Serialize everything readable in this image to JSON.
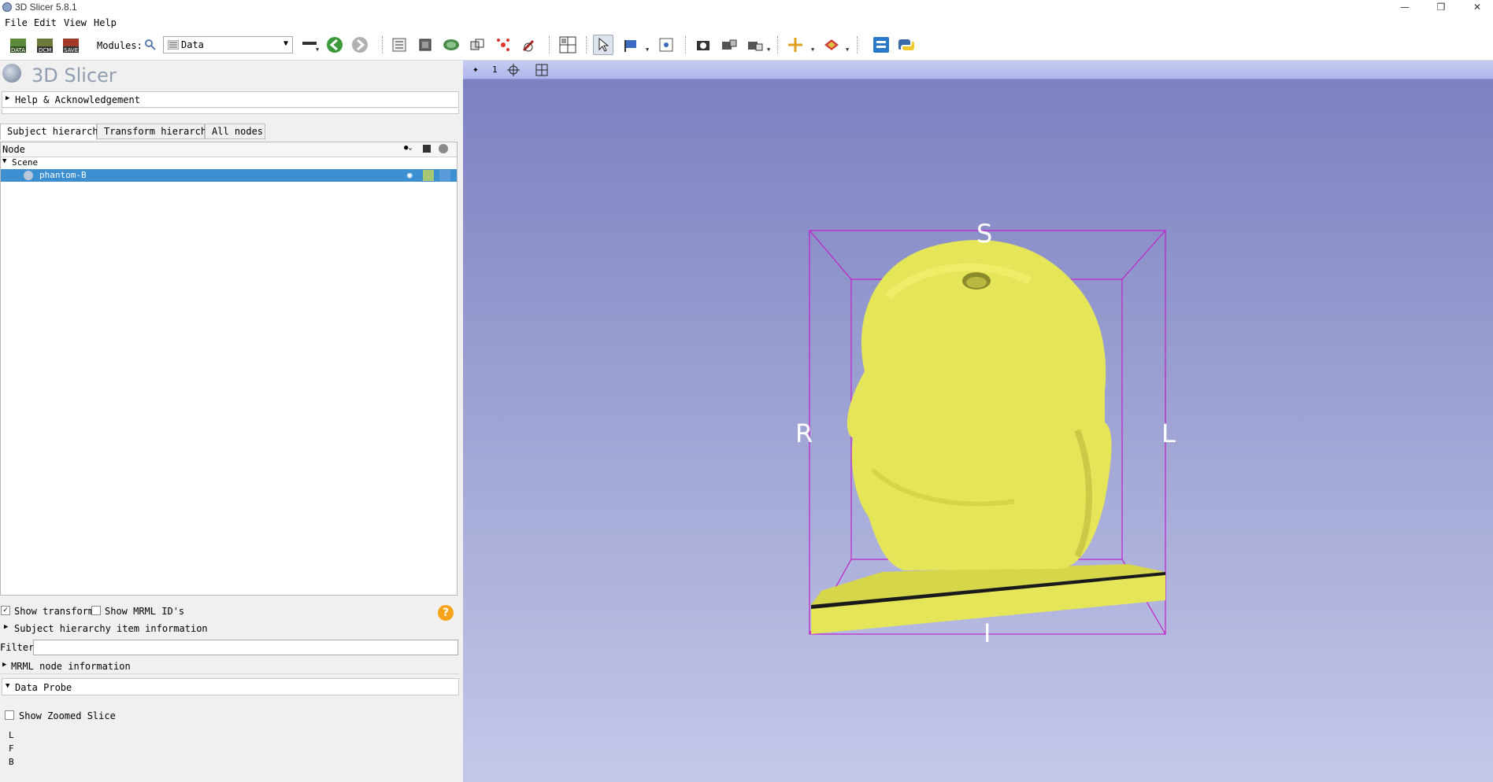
{
  "window": {
    "title": "3D Slicer 5.8.1",
    "controls": [
      "minimize-icon",
      "restore-icon",
      "close-icon"
    ]
  },
  "menu": [
    "File",
    "Edit",
    "View",
    "Help"
  ],
  "toolbar": {
    "modules_label": "Modules:",
    "module_selected": "Data"
  },
  "app": {
    "logo_text": "3D Slicer"
  },
  "sections": {
    "help": "Help & Acknowledgement",
    "subject_info": "Subject hierarchy item information",
    "mrml_info": "MRML node information",
    "data_probe": "Data Probe"
  },
  "tabs": [
    "Subject hierarchy",
    "Transform hierarchy",
    "All nodes"
  ],
  "tree": {
    "header": "Node",
    "scene": "Scene",
    "item": "phantom-B",
    "item_color": "#a6c873"
  },
  "options": {
    "show_transforms": "Show transforms",
    "show_transforms_checked": true,
    "show_mrml_ids": "Show MRML ID's",
    "show_mrml_ids_checked": false
  },
  "filter": {
    "label": "Filter:",
    "value": ""
  },
  "probe": {
    "show_zoomed": "Show Zoomed Slice",
    "lines": [
      "L",
      "F",
      "B"
    ]
  },
  "viewer": {
    "view_number": "1",
    "labels": {
      "top": "S",
      "left": "R",
      "right": "L",
      "bottom": "I"
    },
    "model_color": "#e5e55a",
    "box_color": "#c020c8"
  }
}
